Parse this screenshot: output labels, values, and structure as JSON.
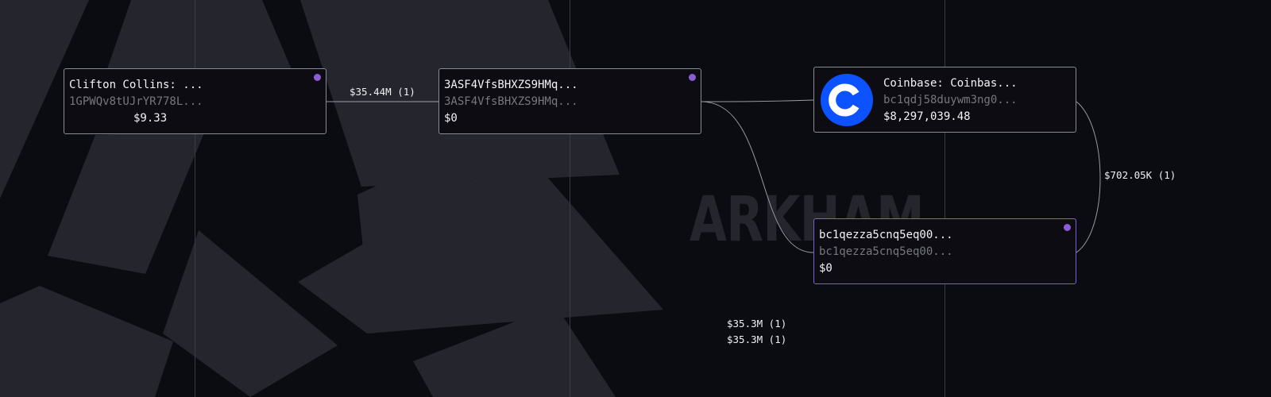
{
  "watermark": "ARKHAM",
  "nodes": [
    {
      "name": "Clifton Collins: ...",
      "address": "1GPWQv8tUJrYR778L...",
      "balance": "$9.33"
    },
    {
      "name": "3ASF4VfsBHXZS9HMq...",
      "address": "3ASF4VfsBHXZS9HMq...",
      "balance": "$0"
    },
    {
      "name": "Coinbase: Coinbas...",
      "address": "bc1qdj58duywm3ng0...",
      "balance": "$8,297,039.48",
      "icon": "coinbase-icon",
      "icon_color": "#0d52ff"
    },
    {
      "name": "bc1qezza5cnq5eq00...",
      "address": "bc1qezza5cnq5eq00...",
      "balance": "$0"
    }
  ],
  "edges": [
    {
      "label": "$35.44M (1)"
    },
    {
      "label": "$702.05K (1)"
    },
    {
      "label": "$35.3M (1)"
    },
    {
      "label": "$35.3M (1)"
    }
  ],
  "colors": {
    "background": "#0b0b12",
    "node_border": "#8a8a92",
    "selected_border": "#7b61d9",
    "status_dot": "#8a5cd6",
    "coinbase_blue": "#0d52ff"
  }
}
